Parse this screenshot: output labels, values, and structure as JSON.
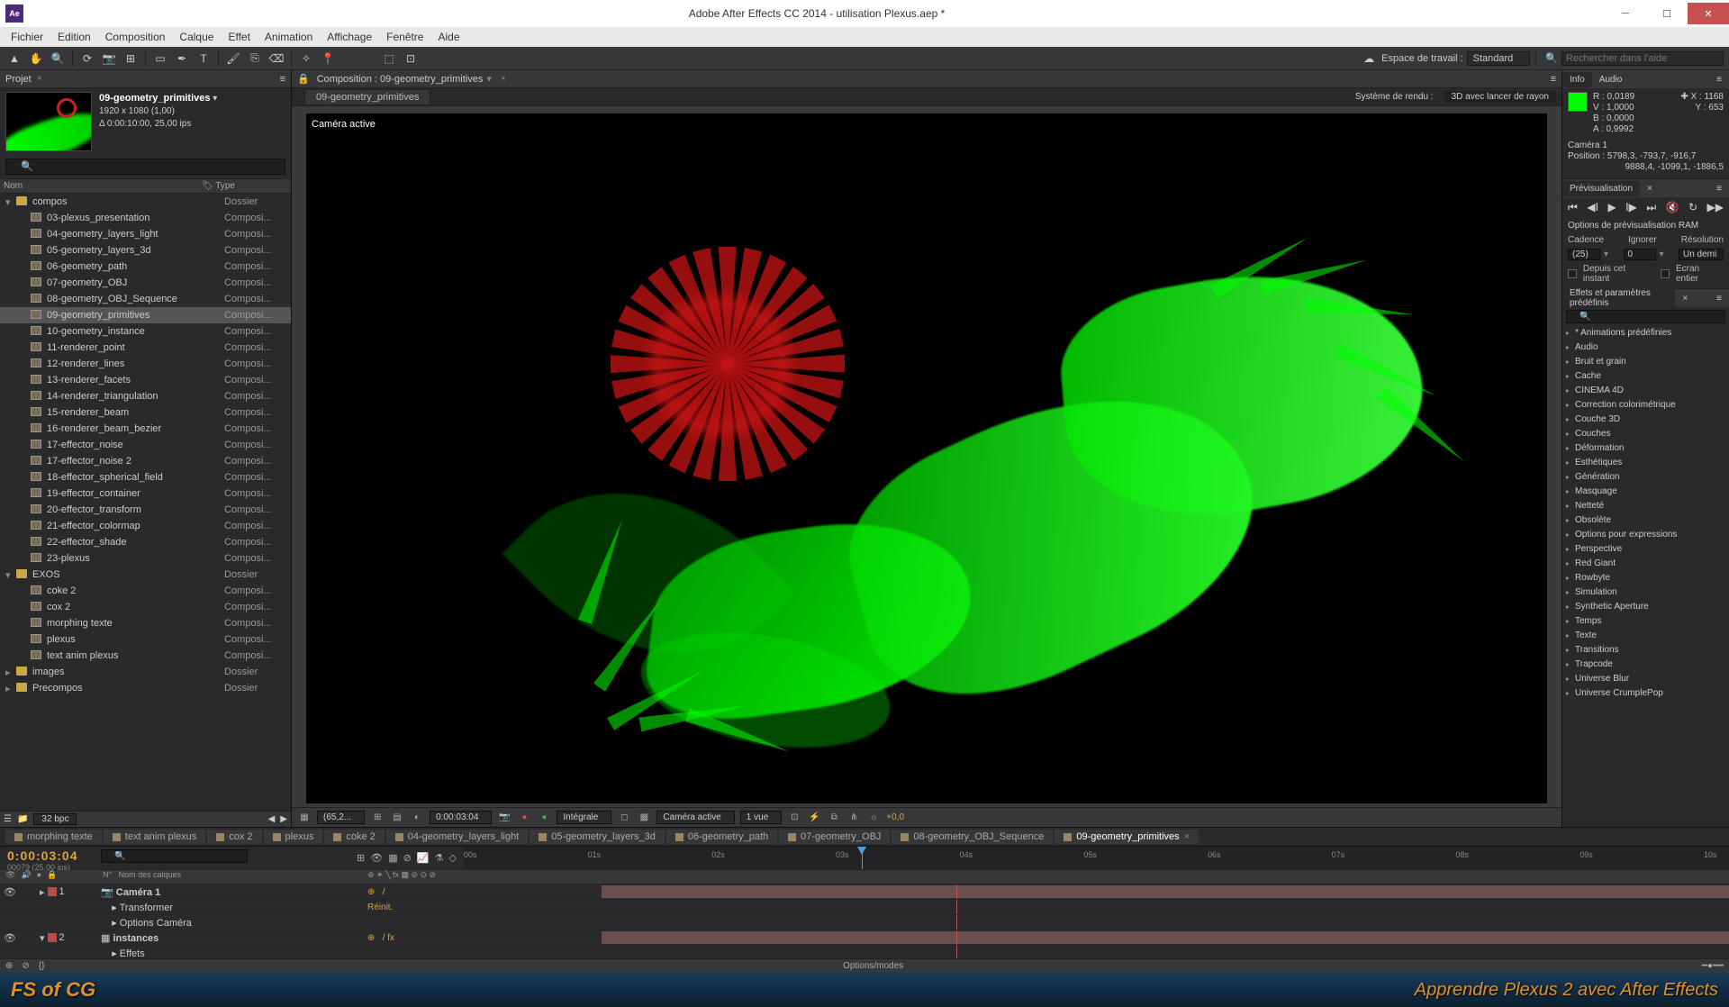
{
  "title": "Adobe After Effects CC 2014 - utilisation Plexus.aep *",
  "menu": [
    "Fichier",
    "Edition",
    "Composition",
    "Calque",
    "Effet",
    "Animation",
    "Affichage",
    "Fenêtre",
    "Aide"
  ],
  "workspace": {
    "label": "Espace de travail :",
    "value": "Standard"
  },
  "search_help": "Rechercher dans l'aide",
  "project_panel": "Projet",
  "comp": {
    "name": "09-geometry_primitives",
    "dims": "1920 x 1080 (1,00)",
    "dur": "Δ 0:00:10:00, 25,00 ips"
  },
  "list_head": {
    "name": "Nom",
    "type": "Type"
  },
  "bpc": "32 bpc",
  "tree": [
    {
      "lvl": 0,
      "tw": "▾",
      "ic": "f",
      "nm": "compos",
      "tp": "Dossier"
    },
    {
      "lvl": 1,
      "tw": "",
      "ic": "c",
      "nm": "03-plexus_presentation",
      "tp": "Composi..."
    },
    {
      "lvl": 1,
      "tw": "",
      "ic": "c",
      "nm": "04-geometry_layers_light",
      "tp": "Composi..."
    },
    {
      "lvl": 1,
      "tw": "",
      "ic": "c",
      "nm": "05-geometry_layers_3d",
      "tp": "Composi..."
    },
    {
      "lvl": 1,
      "tw": "",
      "ic": "c",
      "nm": "06-geometry_path",
      "tp": "Composi..."
    },
    {
      "lvl": 1,
      "tw": "",
      "ic": "c",
      "nm": "07-geometry_OBJ",
      "tp": "Composi..."
    },
    {
      "lvl": 1,
      "tw": "",
      "ic": "c",
      "nm": "08-geometry_OBJ_Sequence",
      "tp": "Composi..."
    },
    {
      "lvl": 1,
      "tw": "",
      "ic": "c",
      "nm": "09-geometry_primitives",
      "tp": "Composi...",
      "sel": true
    },
    {
      "lvl": 1,
      "tw": "",
      "ic": "c",
      "nm": "10-geometry_instance",
      "tp": "Composi..."
    },
    {
      "lvl": 1,
      "tw": "",
      "ic": "c",
      "nm": "11-renderer_point",
      "tp": "Composi..."
    },
    {
      "lvl": 1,
      "tw": "",
      "ic": "c",
      "nm": "12-renderer_lines",
      "tp": "Composi..."
    },
    {
      "lvl": 1,
      "tw": "",
      "ic": "c",
      "nm": "13-renderer_facets",
      "tp": "Composi..."
    },
    {
      "lvl": 1,
      "tw": "",
      "ic": "c",
      "nm": "14-renderer_triangulation",
      "tp": "Composi..."
    },
    {
      "lvl": 1,
      "tw": "",
      "ic": "c",
      "nm": "15-renderer_beam",
      "tp": "Composi..."
    },
    {
      "lvl": 1,
      "tw": "",
      "ic": "c",
      "nm": "16-renderer_beam_bezier",
      "tp": "Composi..."
    },
    {
      "lvl": 1,
      "tw": "",
      "ic": "c",
      "nm": "17-effector_noise",
      "tp": "Composi..."
    },
    {
      "lvl": 1,
      "tw": "",
      "ic": "c",
      "nm": "17-effector_noise 2",
      "tp": "Composi..."
    },
    {
      "lvl": 1,
      "tw": "",
      "ic": "c",
      "nm": "18-effector_spherical_field",
      "tp": "Composi..."
    },
    {
      "lvl": 1,
      "tw": "",
      "ic": "c",
      "nm": "19-effector_container",
      "tp": "Composi..."
    },
    {
      "lvl": 1,
      "tw": "",
      "ic": "c",
      "nm": "20-effector_transform",
      "tp": "Composi..."
    },
    {
      "lvl": 1,
      "tw": "",
      "ic": "c",
      "nm": "21-effector_colormap",
      "tp": "Composi..."
    },
    {
      "lvl": 1,
      "tw": "",
      "ic": "c",
      "nm": "22-effector_shade",
      "tp": "Composi..."
    },
    {
      "lvl": 1,
      "tw": "",
      "ic": "c",
      "nm": "23-plexus",
      "tp": "Composi..."
    },
    {
      "lvl": 0,
      "tw": "▾",
      "ic": "f",
      "nm": "EXOS",
      "tp": "Dossier"
    },
    {
      "lvl": 1,
      "tw": "",
      "ic": "c",
      "nm": "coke 2",
      "tp": "Composi..."
    },
    {
      "lvl": 1,
      "tw": "",
      "ic": "c",
      "nm": "cox 2",
      "tp": "Composi..."
    },
    {
      "lvl": 1,
      "tw": "",
      "ic": "c",
      "nm": "morphing texte",
      "tp": "Composi..."
    },
    {
      "lvl": 1,
      "tw": "",
      "ic": "c",
      "nm": "plexus",
      "tp": "Composi..."
    },
    {
      "lvl": 1,
      "tw": "",
      "ic": "c",
      "nm": "text anim plexus",
      "tp": "Composi..."
    },
    {
      "lvl": 0,
      "tw": "▸",
      "ic": "f",
      "nm": "images",
      "tp": "Dossier"
    },
    {
      "lvl": 0,
      "tw": "▸",
      "ic": "f",
      "nm": "Precompos",
      "tp": "Dossier"
    }
  ],
  "center": {
    "tab": "Composition : 09-geometry_primitives",
    "subtab": "09-geometry_primitives",
    "renderer_lbl": "Système de rendu :",
    "renderer": "3D avec lancer de rayon",
    "camera": "Caméra active",
    "foot": {
      "zoom": "(65,2...",
      "time": "0:00:03:04",
      "res": "Intégrale",
      "cam": "Caméra active",
      "view": "1 vue",
      "exp": "+0,0"
    }
  },
  "tabs": [
    "morphing texte",
    "text anim plexus",
    "cox 2",
    "plexus",
    "coke 2",
    "04-geometry_layers_light",
    "05-geometry_layers_3d",
    "06-geometry_path",
    "07-geometry_OBJ",
    "08-geometry_OBJ_Sequence",
    "09-geometry_primitives"
  ],
  "tabs_active": 10,
  "info": {
    "tab1": "Info",
    "tab2": "Audio",
    "R": "R : 0,0189",
    "G": "V : 1,0000",
    "B": "B : 0,0000",
    "A": "A : 0,9992",
    "X": "X : 1168",
    "Y": "Y : 653",
    "cam": "Caméra 1",
    "pos": "Position : 5798,3, -793,7, -916,7",
    "pos2": "9888,4, -1099,1, -1886,5"
  },
  "preview": {
    "title": "Prévisualisation",
    "ram": "Options de prévisualisation RAM",
    "cadence": "Cadence",
    "ignorer": "Ignorer",
    "resolution": "Résolution",
    "cad_v": "(25)",
    "ign_v": "0",
    "res_v": "Un demi",
    "chk1": "Depuis cet instant",
    "chk2": "Ecran entier"
  },
  "effects": {
    "title": "Effets et paramètres prédéfinis",
    "list": [
      "* Animations prédéfinies",
      "Audio",
      "Bruit et grain",
      "Cache",
      "CINEMA 4D",
      "Correction colorimétrique",
      "Couche 3D",
      "Couches",
      "Déformation",
      "Esthétiques",
      "Génération",
      "Masquage",
      "Netteté",
      "Obsolète",
      "Options pour expressions",
      "Perspective",
      "Red Giant",
      "Rowbyte",
      "Simulation",
      "Synthetic Aperture",
      "Temps",
      "Texte",
      "Transitions",
      "Trapcode",
      "Universe Blur",
      "Universe CrumplePop"
    ]
  },
  "timeline": {
    "time": "0:00:03:04",
    "frames": "00079 (25.00 ips)",
    "cols": {
      "num": "N°",
      "source": "Nom des calques"
    },
    "ticks": [
      "00s",
      "01s",
      "02s",
      "03s",
      "04s",
      "05s",
      "06s",
      "07s",
      "08s",
      "09s",
      "10s"
    ],
    "layers": [
      {
        "n": "1",
        "name": "Caméra 1",
        "reset": "Réinit.",
        "children": [
          "Transformer",
          "Options Caméra"
        ]
      },
      {
        "n": "2",
        "name": "instances",
        "children": [
          "Effets"
        ]
      }
    ],
    "footer": "Options/modes"
  },
  "watermark": {
    "logo": "FS of CG",
    "tag": "Apprendre Plexus 2 avec After Effects"
  }
}
